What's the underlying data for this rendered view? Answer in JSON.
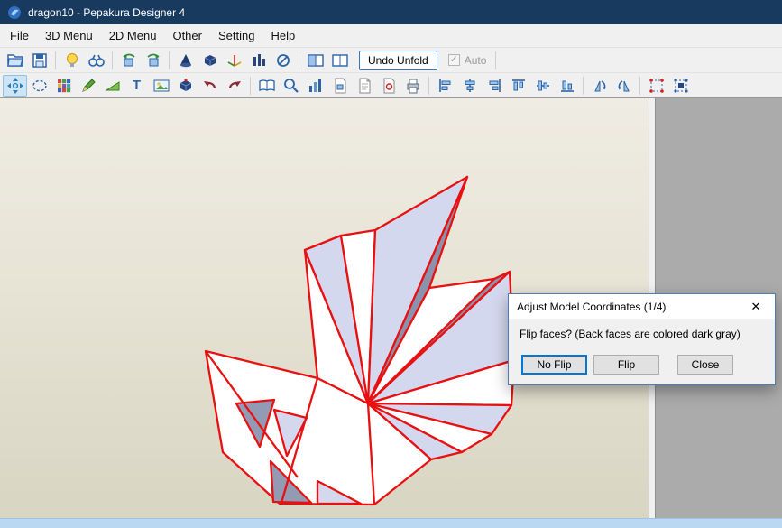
{
  "window": {
    "title": "dragon10 - Pepakura Designer 4"
  },
  "menubar": {
    "items": [
      "File",
      "3D Menu",
      "2D Menu",
      "Other",
      "Setting",
      "Help"
    ]
  },
  "toolbar_top": {
    "undo_unfold": "Undo Unfold",
    "auto_label": "Auto",
    "check_glyph": "✓",
    "icons": [
      "open-file",
      "save-file",
      "light-toggle",
      "view-binoculars",
      "rotate-model-left",
      "rotate-model-right",
      "show-cone",
      "show-solid",
      "show-axes",
      "scale-bars",
      "measure-ring",
      "layout-split-left",
      "layout-split-right"
    ]
  },
  "toolbar_2d": {
    "text_tool_glyph": "T",
    "icons": [
      "pan-view",
      "circle-select",
      "texture-grid",
      "pen-edge",
      "slope-edge",
      "insert-text",
      "insert-image",
      "solid-box",
      "undo",
      "redo",
      "book-pages",
      "fit-window",
      "parts-chart",
      "page-number",
      "page-copy",
      "page-target",
      "print",
      "align-left",
      "align-center-h",
      "align-right",
      "align-top",
      "align-middle",
      "align-bottom",
      "rotate-part-ccw",
      "rotate-part-cw",
      "select-corners",
      "select-mesh"
    ]
  },
  "dialog": {
    "title": "Adjust Model Coordinates (1/4)",
    "message": "Flip faces? (Back faces are colored dark gray)",
    "no_flip": "No Flip",
    "flip": "Flip",
    "close": "Close",
    "close_glyph": "✕"
  },
  "colors": {
    "titlebar": "#173a5e",
    "accent": "#0078d7",
    "model_edge_red": "#e81111",
    "face_white": "#ffffff",
    "face_lavender": "#d4d8ee",
    "face_dark_gray": "#8a92ac",
    "viewport_beige": "#e7e3d5",
    "pane_gray": "#ababab",
    "statusbar_blue": "#bad8f2"
  }
}
